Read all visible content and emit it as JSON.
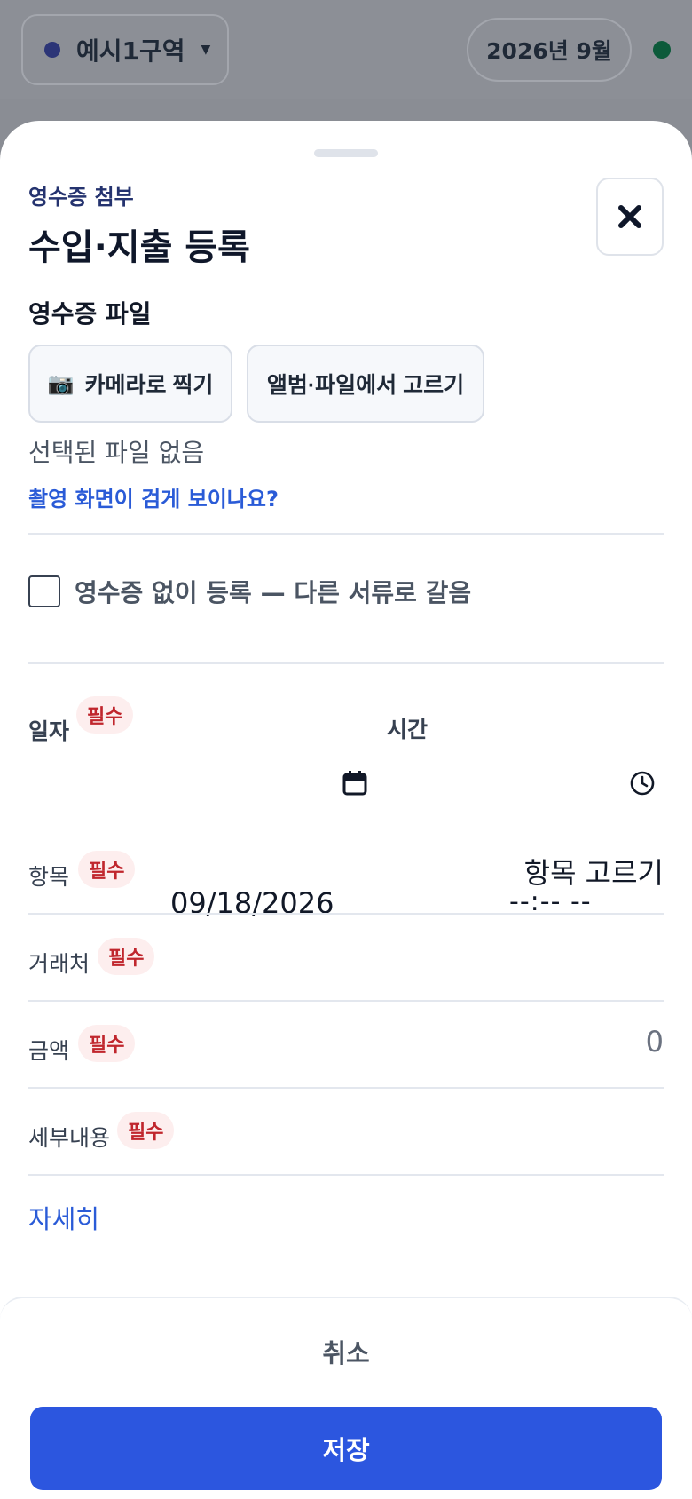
{
  "header": {
    "region_label": "예시1구역",
    "region_caret": "▼",
    "month_label": "2026년 9월"
  },
  "sheet": {
    "eyebrow": "영수증 첨부",
    "title": "수입·지출 등록",
    "close_icon": "close-icon"
  },
  "receipt": {
    "section_label": "영수증 파일",
    "camera_glyph": "📷",
    "camera_label": "카메라로 찍기",
    "album_label": "앨범·파일에서 고르기",
    "no_file_text": "선택된 파일 없음",
    "help_link": "촬영 화면이 검게 보이나요?",
    "no_receipt_label": "영수증 없이 등록 — 다른 서류로 갈음",
    "no_receipt_checked": false
  },
  "form": {
    "required_badge": "필수",
    "date_label": "일자",
    "date_value": "09/18/2026",
    "time_label": "시간",
    "time_value": "--:-- --",
    "item_label": "항목",
    "item_value": "항목 고르기",
    "vendor_label": "거래처",
    "vendor_value": "",
    "amount_label": "금액",
    "amount_value": "0",
    "detail_label": "세부내용",
    "detail_value": "",
    "more_link": "자세히"
  },
  "footer": {
    "cancel_label": "취소",
    "save_label": "저장"
  },
  "colors": {
    "accent": "#2c56df",
    "link": "#2a5bd7",
    "required_text": "#c0262d",
    "required_bg": "#fdeeee",
    "eyebrow": "#25336f",
    "region_dot": "#2c3577",
    "status_dot": "#0c5a3a"
  }
}
